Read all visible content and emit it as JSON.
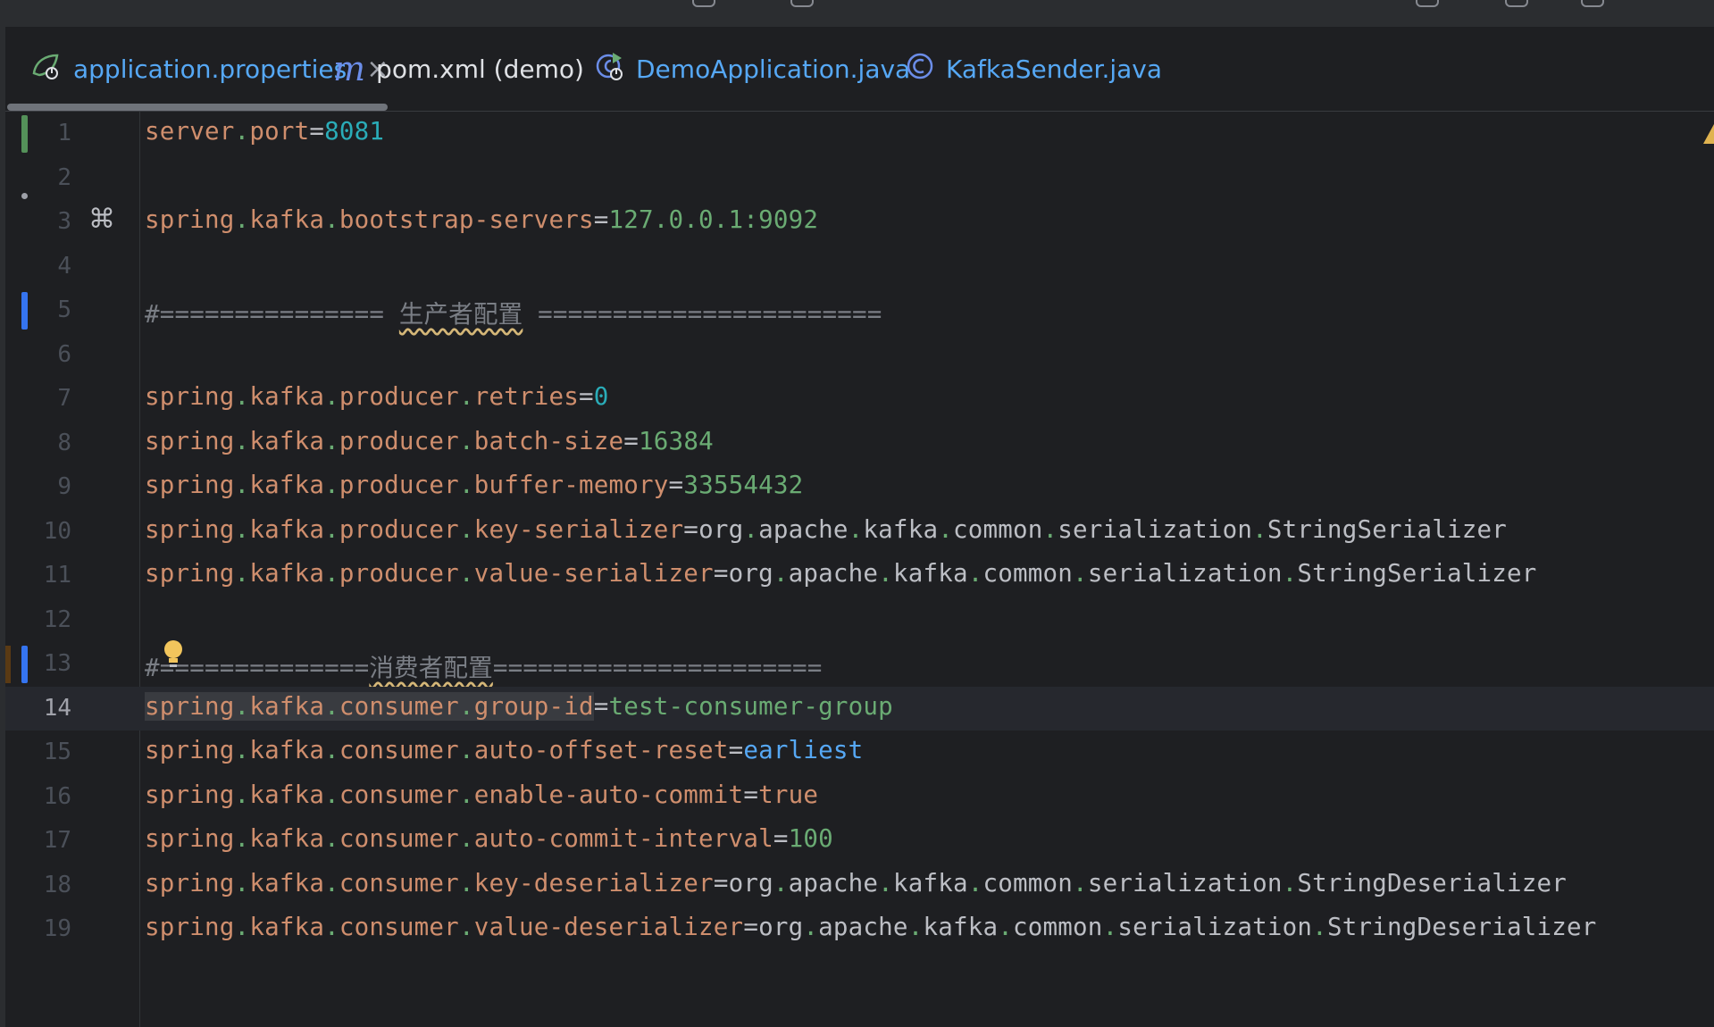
{
  "tabs": [
    {
      "label": "application.properties",
      "icon": "spring-boot-icon",
      "active": true,
      "close": "×"
    },
    {
      "label": "pom.xml (demo)",
      "icon": "maven-icon"
    },
    {
      "label": "DemoApplication.java",
      "icon": "spring-run-class-icon"
    },
    {
      "label": "KafkaSender.java",
      "icon": "class-icon"
    }
  ],
  "maven_glyph": "m",
  "command_glyph": "⌘",
  "current_line": 14,
  "lines": [
    {
      "n": "1",
      "key": [
        "server",
        "port"
      ],
      "value": "8081",
      "vtype": "num"
    },
    {
      "n": "2"
    },
    {
      "n": "3",
      "key": [
        "spring",
        "kafka",
        "bootstrap-servers"
      ],
      "value": "127.0.0.1:9092",
      "vtype": "str"
    },
    {
      "n": "4"
    },
    {
      "n": "5",
      "comment_pre": "#=============== ",
      "comment_cjk": "生产者配置",
      "comment_post": " ======================="
    },
    {
      "n": "6"
    },
    {
      "n": "7",
      "key": [
        "spring",
        "kafka",
        "producer",
        "retries"
      ],
      "value": "0",
      "vtype": "num"
    },
    {
      "n": "8",
      "key": [
        "spring",
        "kafka",
        "producer",
        "batch-size"
      ],
      "value": "16384",
      "vtype": "str"
    },
    {
      "n": "9",
      "key": [
        "spring",
        "kafka",
        "producer",
        "buffer-memory"
      ],
      "value": "33554432",
      "vtype": "str"
    },
    {
      "n": "10",
      "key": [
        "spring",
        "kafka",
        "producer",
        "key-serializer"
      ],
      "value": [
        "org",
        "apache",
        "kafka",
        "common",
        "serialization",
        "StringSerializer"
      ],
      "vtype": "cls"
    },
    {
      "n": "11",
      "key": [
        "spring",
        "kafka",
        "producer",
        "value-serializer"
      ],
      "value": [
        "org",
        "apache",
        "kafka",
        "common",
        "serialization",
        "StringSerializer"
      ],
      "vtype": "cls"
    },
    {
      "n": "12"
    },
    {
      "n": "13",
      "comment_pre": "#==============",
      "comment_cjk": "消费者配置",
      "comment_post": "======================"
    },
    {
      "n": "14",
      "key": [
        "spring",
        "kafka",
        "consumer",
        "group-id"
      ],
      "value": "test-consumer-group",
      "vtype": "str"
    },
    {
      "n": "15",
      "key": [
        "spring",
        "kafka",
        "consumer",
        "auto-offset-reset"
      ],
      "value": "earliest",
      "vtype": "kw"
    },
    {
      "n": "16",
      "key": [
        "spring",
        "kafka",
        "consumer",
        "enable-auto-commit"
      ],
      "value": "true",
      "vtype": "bool"
    },
    {
      "n": "17",
      "key": [
        "spring",
        "kafka",
        "consumer",
        "auto-commit-interval"
      ],
      "value": "100",
      "vtype": "str"
    },
    {
      "n": "18",
      "key": [
        "spring",
        "kafka",
        "consumer",
        "key-deserializer"
      ],
      "value": [
        "org",
        "apache",
        "kafka",
        "common",
        "serialization",
        "StringDeserializer"
      ],
      "vtype": "cls"
    },
    {
      "n": "19",
      "key": [
        "spring",
        "kafka",
        "consumer",
        "value-deserializer"
      ],
      "value": [
        "org",
        "apache",
        "kafka",
        "common",
        "serialization",
        "StringDeserializer"
      ],
      "vtype": "cls"
    }
  ],
  "colors": {
    "background": "#1e1f22",
    "key": "#cf8e6d",
    "string": "#6aab73",
    "number": "#2aacb8",
    "keyword": "#56a8f5",
    "comment": "#7a7e85",
    "vcs_added": "#549159",
    "vcs_modified": "#3574f0"
  }
}
